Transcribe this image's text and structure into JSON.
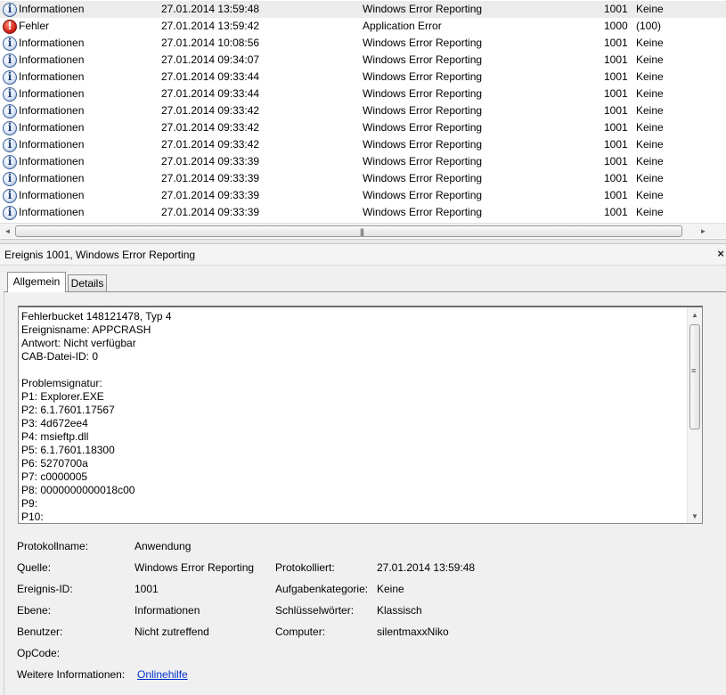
{
  "events": [
    {
      "level": "Informationen",
      "type": "info",
      "date": "27.01.2014 13:59:48",
      "source": "Windows Error Reporting",
      "event_id": "1001",
      "category": "Keine",
      "selected": true
    },
    {
      "level": "Fehler",
      "type": "error",
      "date": "27.01.2014 13:59:42",
      "source": "Application Error",
      "event_id": "1000",
      "category": "(100)"
    },
    {
      "level": "Informationen",
      "type": "info",
      "date": "27.01.2014 10:08:56",
      "source": "Windows Error Reporting",
      "event_id": "1001",
      "category": "Keine"
    },
    {
      "level": "Informationen",
      "type": "info",
      "date": "27.01.2014 09:34:07",
      "source": "Windows Error Reporting",
      "event_id": "1001",
      "category": "Keine"
    },
    {
      "level": "Informationen",
      "type": "info",
      "date": "27.01.2014 09:33:44",
      "source": "Windows Error Reporting",
      "event_id": "1001",
      "category": "Keine"
    },
    {
      "level": "Informationen",
      "type": "info",
      "date": "27.01.2014 09:33:44",
      "source": "Windows Error Reporting",
      "event_id": "1001",
      "category": "Keine"
    },
    {
      "level": "Informationen",
      "type": "info",
      "date": "27.01.2014 09:33:42",
      "source": "Windows Error Reporting",
      "event_id": "1001",
      "category": "Keine"
    },
    {
      "level": "Informationen",
      "type": "info",
      "date": "27.01.2014 09:33:42",
      "source": "Windows Error Reporting",
      "event_id": "1001",
      "category": "Keine"
    },
    {
      "level": "Informationen",
      "type": "info",
      "date": "27.01.2014 09:33:42",
      "source": "Windows Error Reporting",
      "event_id": "1001",
      "category": "Keine"
    },
    {
      "level": "Informationen",
      "type": "info",
      "date": "27.01.2014 09:33:39",
      "source": "Windows Error Reporting",
      "event_id": "1001",
      "category": "Keine"
    },
    {
      "level": "Informationen",
      "type": "info",
      "date": "27.01.2014 09:33:39",
      "source": "Windows Error Reporting",
      "event_id": "1001",
      "category": "Keine"
    },
    {
      "level": "Informationen",
      "type": "info",
      "date": "27.01.2014 09:33:39",
      "source": "Windows Error Reporting",
      "event_id": "1001",
      "category": "Keine"
    },
    {
      "level": "Informationen",
      "type": "info",
      "date": "27.01.2014 09:33:39",
      "source": "Windows Error Reporting",
      "event_id": "1001",
      "category": "Keine"
    }
  ],
  "detail": {
    "title": "Ereignis 1001, Windows Error Reporting",
    "close_glyph": "×",
    "tabs": {
      "general": "Allgemein",
      "details": "Details"
    },
    "description": "Fehlerbucket 148121478, Typ 4\nEreignisname: APPCRASH\nAntwort: Nicht verfügbar\nCAB-Datei-ID: 0\n\nProblemsignatur:\nP1: Explorer.EXE\nP2: 6.1.7601.17567\nP3: 4d672ee4\nP4: msieftp.dll\nP5: 6.1.7601.18300\nP6: 5270700a\nP7: c0000005\nP8: 0000000000018c00\nP9:\nP10:",
    "fields": {
      "log_name_label": "Protokollname:",
      "log_name": "Anwendung",
      "source_label": "Quelle:",
      "source": "Windows Error Reporting",
      "logged_label": "Protokolliert:",
      "logged": "27.01.2014 13:59:48",
      "event_id_label": "Ereignis-ID:",
      "event_id": "1001",
      "task_category_label": "Aufgabenkategorie:",
      "task_category": "Keine",
      "level_label": "Ebene:",
      "level": "Informationen",
      "keywords_label": "Schlüsselwörter:",
      "keywords": "Klassisch",
      "user_label": "Benutzer:",
      "user": "Nicht zutreffend",
      "computer_label": "Computer:",
      "computer": "silentmaxxNiko",
      "opcode_label": "OpCode:",
      "more_info_label": "Weitere Informationen:",
      "more_info_link": "Onlinehilfe"
    }
  },
  "scrollbars": {
    "h_left": "◄",
    "h_right": "►",
    "h_grip": "|||",
    "v_up": "▲",
    "v_down": "▼",
    "v_grip": "≡"
  }
}
